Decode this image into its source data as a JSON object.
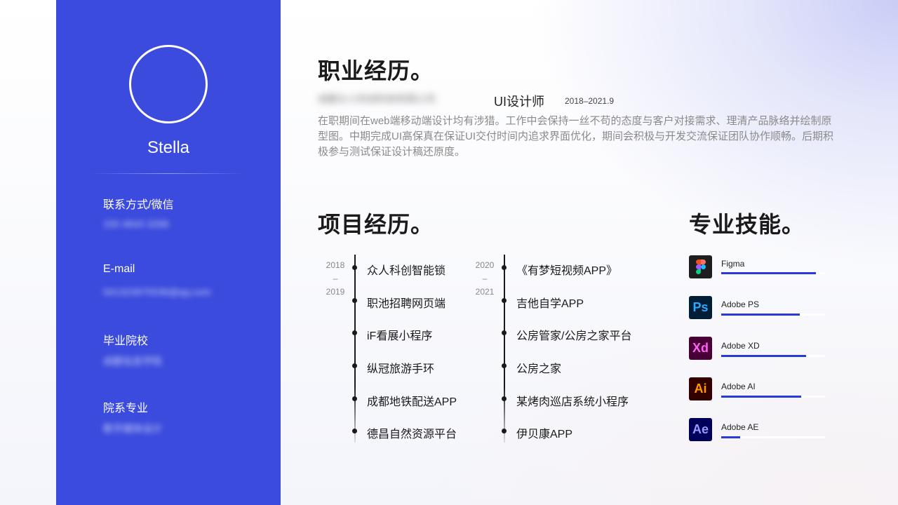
{
  "profile": {
    "name": "Stella",
    "contact_label": "联系方式/微信",
    "contact_value": "150 4643 3268",
    "email_label": "E-mail",
    "email_value": "541323975536@qq.com",
    "school_label": "毕业院校",
    "school_value": "成都信息学院",
    "major_label": "院系专业",
    "major_value": "数字媒体设计"
  },
  "work": {
    "heading": "职业经历。",
    "company": "成都众人科创科技有限公司",
    "role": "UI设计师",
    "period": "2018–2021.9",
    "description": "在职期间在web端移动端设计均有涉猎。工作中会保持一丝不苟的态度与客户对接需求、理清产品脉络并绘制原型图。中期完成UI高保真在保证UI交付时间内追求界面优化，期间会积极与开发交流保证团队协作顺畅。后期积极参与测试保证设计稿还原度。"
  },
  "projects": {
    "heading": "项目经历。",
    "groups": [
      {
        "year_start": "2018",
        "year_sep": "–",
        "year_end": "2019",
        "items": [
          "众人科创智能锁",
          "职池招聘网页端",
          "iF看展小程序",
          "纵冠旅游手环",
          "成都地铁配送APP",
          "德昌自然资源平台"
        ]
      },
      {
        "year_start": "2020",
        "year_sep": "–",
        "year_end": "2021",
        "items": [
          "《有梦短视频APP》",
          "吉他自学APP",
          "公房管家/公房之家平台",
          "公房之家",
          "某烤肉巡店系统小程序",
          "伊贝康APP"
        ]
      }
    ]
  },
  "skills": {
    "heading": "专业技能。",
    "items": [
      {
        "name": "Figma",
        "icon": "figma-icon",
        "abbr": "",
        "level": 0.91,
        "bg": "#1e1e1e",
        "fg": "#ffffff"
      },
      {
        "name": "Adobe PS",
        "icon": "photoshop-icon",
        "abbr": "Ps",
        "level": 0.76,
        "bg": "#001e36",
        "fg": "#31a8ff"
      },
      {
        "name": "Adobe XD",
        "icon": "xd-icon",
        "abbr": "Xd",
        "level": 0.82,
        "bg": "#470137",
        "fg": "#ff61f6"
      },
      {
        "name": "Adobe AI",
        "icon": "illustrator-icon",
        "abbr": "Ai",
        "level": 0.77,
        "bg": "#330000",
        "fg": "#ff9a00"
      },
      {
        "name": "Adobe AE",
        "icon": "after-effects-icon",
        "abbr": "Ae",
        "level": 0.18,
        "bg": "#00005b",
        "fg": "#9999ff"
      }
    ]
  },
  "colors": {
    "sidebar": "#3a4bdd",
    "accent": "#2a3ad4"
  }
}
